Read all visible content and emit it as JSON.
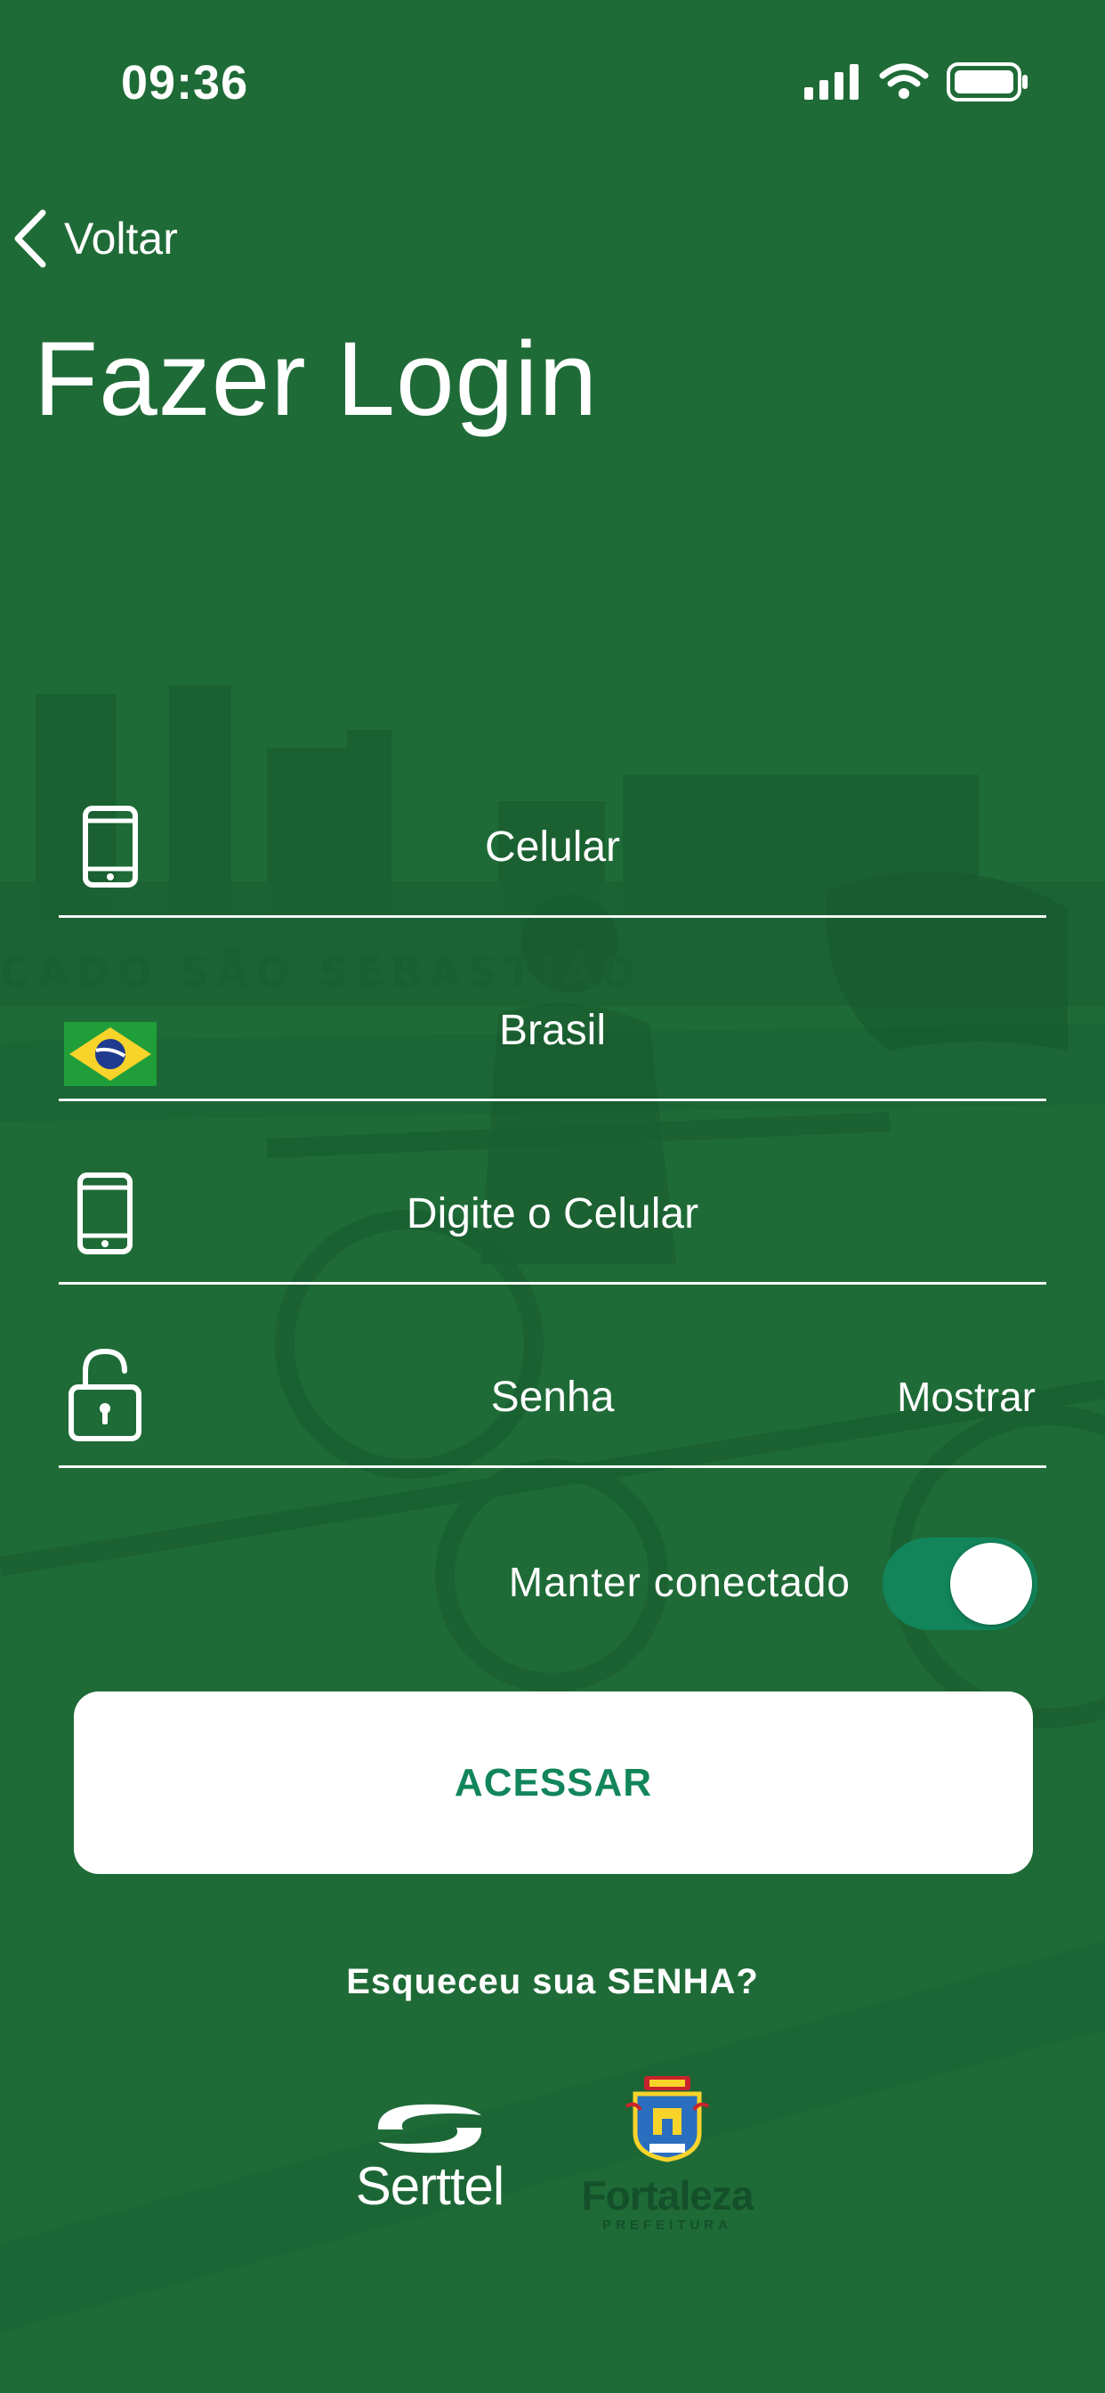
{
  "status_bar": {
    "time": "09:36"
  },
  "nav": {
    "back_label": "Voltar"
  },
  "page": {
    "title": "Fazer Login"
  },
  "background": {
    "sign_text": "CADO SÃO SEBASTIÃO"
  },
  "form": {
    "phone_type": {
      "value": "Celular"
    },
    "country": {
      "value": "Brasil"
    },
    "phone_number": {
      "placeholder": "Digite o Celular"
    },
    "password": {
      "placeholder": "Senha",
      "show_label": "Mostrar"
    },
    "keep_connected": {
      "label": "Manter conectado",
      "enabled": true
    },
    "submit_label": "ACESSAR",
    "forgot_label": "Esqueceu sua SENHA?"
  },
  "footer": {
    "logo_serttel": "Serttel",
    "logo_fortaleza": "Fortaleza",
    "logo_fortaleza_sub": "PREFEITURA"
  },
  "colors": {
    "background": "#1f6b37",
    "accent": "#12855b",
    "text": "#ffffff",
    "button_bg": "#ffffff"
  }
}
